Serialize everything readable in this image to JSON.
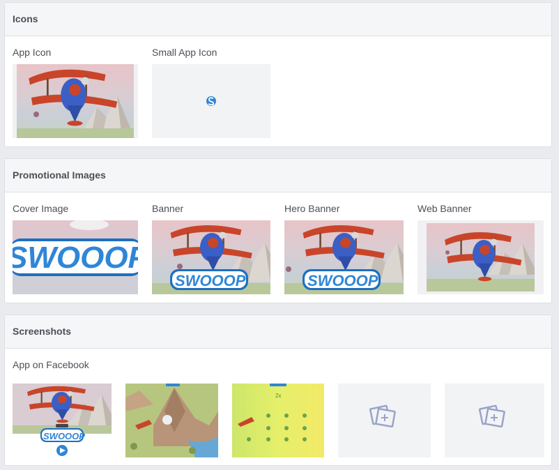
{
  "sections": {
    "icons": {
      "title": "Icons",
      "items": [
        {
          "label": "App Icon"
        },
        {
          "label": "Small App Icon"
        }
      ]
    },
    "promotional": {
      "title": "Promotional Images",
      "items": [
        {
          "label": "Cover Image",
          "logo_text": "SWOOOP"
        },
        {
          "label": "Banner",
          "logo_text": "SWOOOP"
        },
        {
          "label": "Hero Banner",
          "logo_text": "SWOOOP"
        },
        {
          "label": "Web Banner"
        }
      ]
    },
    "screenshots": {
      "title": "Screenshots",
      "group_label": "App on Facebook",
      "items": [
        {
          "logo_text": "SWOOOP"
        },
        {},
        {
          "badge": "2x"
        },
        {},
        {}
      ]
    }
  },
  "colors": {
    "background": "#e9ebee",
    "panel_header": "#f5f6f7",
    "border": "#dddfe2",
    "text": "#4b4f56",
    "plane_red": "#c8452a",
    "plane_blue": "#3b5fc4",
    "logo_blue": "#2f86d6",
    "placeholder_icon": "#9aa3c7"
  }
}
